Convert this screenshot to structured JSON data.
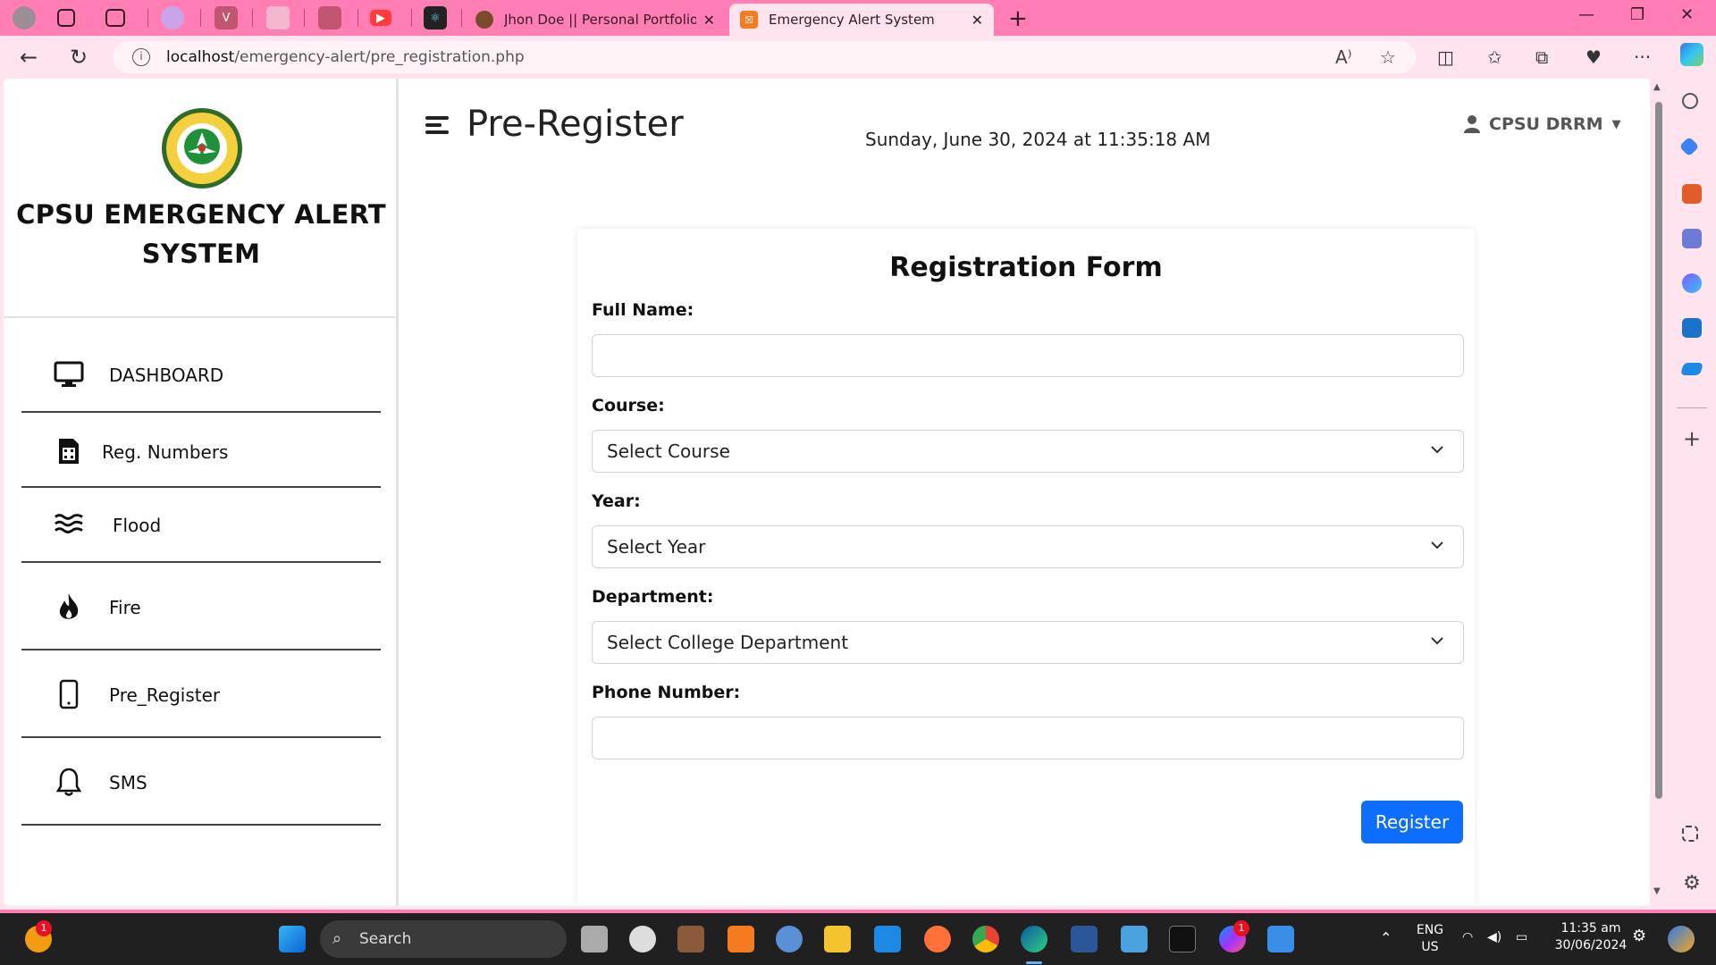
{
  "browser": {
    "tabs": [
      {
        "title": "Jhon Doe || Personal Portfolio",
        "active": false
      },
      {
        "title": "Emergency Alert System",
        "active": true
      }
    ],
    "url_host": "localhost",
    "url_path": "/emergency-alert/pre_registration.php"
  },
  "sidebar": {
    "brand_line1": "CPSU EMERGENCY ALERT",
    "brand_line2": "SYSTEM",
    "items": [
      {
        "label": "DASHBOARD",
        "icon": "monitor-icon"
      },
      {
        "label": "Reg. Numbers",
        "icon": "sim-card-icon"
      },
      {
        "label": "Flood",
        "icon": "water-waves-icon"
      },
      {
        "label": "Fire",
        "icon": "fire-icon"
      },
      {
        "label": "Pre_Register",
        "icon": "mobile-phone-icon"
      },
      {
        "label": "SMS",
        "icon": "bell-icon"
      }
    ]
  },
  "header": {
    "title": "Pre-Register",
    "datetime": "Sunday, June 30, 2024 at 11:35:18 AM",
    "user": "CPSU DRRM"
  },
  "form": {
    "title": "Registration Form",
    "full_name_label": "Full Name:",
    "full_name_value": "",
    "course_label": "Course:",
    "course_selected": "Select Course",
    "year_label": "Year:",
    "year_selected": "Select Year",
    "department_label": "Department:",
    "department_selected": "Select College Department",
    "phone_label": "Phone Number:",
    "phone_value": "",
    "submit_label": "Register"
  },
  "taskbar": {
    "search_label": "Search",
    "lang_line1": "ENG",
    "lang_line2": "US",
    "time": "11:35 am",
    "date": "30/06/2024",
    "notif_badge": "1",
    "messenger_badge": "1"
  },
  "colors": {
    "accent": "#0d6efd",
    "browser_frame": "#ff7fb5",
    "browser_toolbar": "#ffe3ef"
  }
}
